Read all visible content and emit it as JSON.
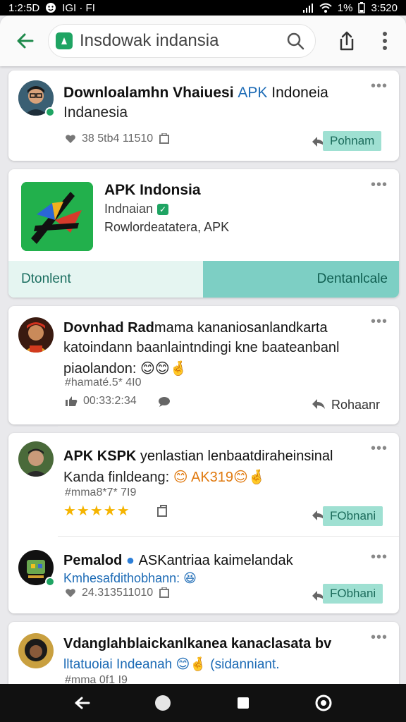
{
  "status_bar": {
    "left_time": "1:2:5D",
    "left_text": "IGI · FI",
    "battery": "1%",
    "time": "3:520"
  },
  "toolbar": {
    "search_text": "Insdowak indansia"
  },
  "cards": [
    {
      "title": "Downloalamhn Vhaiuesi",
      "title_link": "APK",
      "title_rest": "Indoneia",
      "line2": "Indanesia",
      "meta": "38 5tb4 11510",
      "action": "Pohnam"
    }
  ],
  "app": {
    "title": "APK Indonsia",
    "developer": "Indnaian",
    "description": "Rowlordeatatera, APK",
    "btn_left": "Dtonlent",
    "btn_right": "Dentanlcale"
  },
  "posts": [
    {
      "title": "Dovnhad Rad",
      "title_rest": "mama kananiosanlandkarta",
      "line2": "katoindann baanlaintndingi kne baateanbanl",
      "line3": "piaolandon:",
      "emoji": "😊😊🤞",
      "tag": "#hamaté.5* 4I0",
      "meta": "00:33:2:34",
      "action": "Rohaanr"
    },
    {
      "title": "APK KSPK",
      "title_rest": "yenlastian lenbaatdiraheinsinal",
      "line2": "Kanda finldeang:",
      "emoji_text": "😊 AK319😊🤞",
      "tag": "#mma8*7* 7I9",
      "stars": "★★★★★",
      "action": "FObnani"
    },
    {
      "title": "Pemalod",
      "title_rest": "ASKantriaa kaimelandak",
      "line2": "Kmhesafdithobhann:",
      "line2_emoji": "😆",
      "meta": "24.313511010",
      "action": "FObhani"
    },
    {
      "title": "Vdanglahblaickanlkanea kanaclasata bv",
      "line2": "lltatuoiai Indeanah",
      "line2_emoji": "😊🤞",
      "line2_rest": "(sidanniant.",
      "tag": "#mma 0f1 I9",
      "stars": "★★★★★"
    }
  ],
  "colors": {
    "accent_green": "#1fa463",
    "action_teal": "#9fe0d2",
    "link_blue": "#1b6ab5",
    "star": "#f5b400"
  },
  "icons": {
    "back": "arrow-left-icon",
    "search": "search-icon",
    "share": "share-icon",
    "more": "more-vert-icon",
    "like": "heart-icon",
    "reply": "reply-icon",
    "nav_back": "nav-back-icon",
    "nav_home": "nav-home-icon",
    "nav_recent": "nav-recent-icon",
    "nav_assistant": "nav-assistant-icon"
  }
}
